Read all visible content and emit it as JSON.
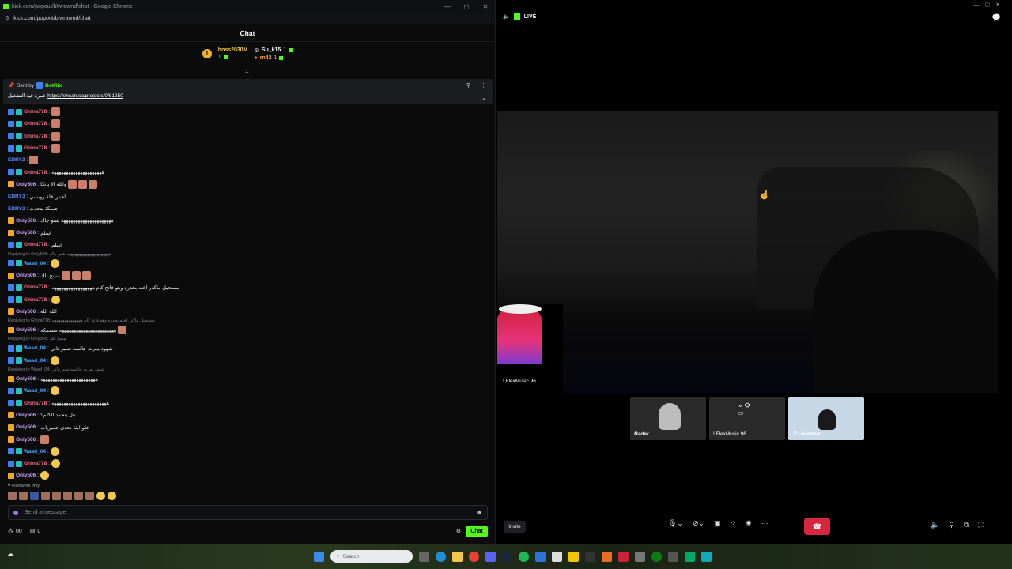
{
  "window": {
    "title": "kick.com/popout/blwrawnd/chat - Google Chrome",
    "url": "kick.com/popout/blwrawnd/chat"
  },
  "chat": {
    "header": "Chat",
    "gifters": [
      {
        "rank": "1",
        "name": "boss2030M",
        "count": "1"
      },
      {
        "name": "Su_k15",
        "count": "1"
      },
      {
        "name": "rn42",
        "count": "1"
      }
    ],
    "pinned": {
      "sent_by_label": "Sent by",
      "sender": "BotRix",
      "text": "عمرة قيد التشغيل",
      "link": "https://ehsan.sa/projects/0/81250"
    },
    "messages": [
      {
        "type": "msg",
        "user": "Ghina778",
        "color": "ghina",
        "badges": [
          "blue",
          "teal"
        ],
        "text": "",
        "emotes": 1
      },
      {
        "type": "msg",
        "user": "Ghina778",
        "color": "ghina",
        "badges": [
          "blue",
          "teal"
        ],
        "text": "",
        "emotes": 1
      },
      {
        "type": "msg",
        "user": "Ghina778",
        "color": "ghina",
        "badges": [
          "blue",
          "teal"
        ],
        "text": "",
        "emotes": 1
      },
      {
        "type": "msg",
        "user": "Ghina778",
        "color": "ghina",
        "badges": [
          "blue",
          "teal"
        ],
        "text": "",
        "emotes": 1
      },
      {
        "type": "msg",
        "user": "EDRY3",
        "color": "edry",
        "badges": [],
        "text": "",
        "emotes": 1
      },
      {
        "type": "msg",
        "user": "Ghina778",
        "color": "ghina",
        "badges": [
          "blue",
          "teal"
        ],
        "text": "هههههههههههههههههههههه",
        "emotes": 0
      },
      {
        "type": "msg",
        "user": "Only506",
        "color": "only",
        "badges": [
          "gold"
        ],
        "text": "والله الا يانكا",
        "emotes": 3
      },
      {
        "type": "msg",
        "user": "EDRY3",
        "color": "edry",
        "badges": [],
        "text": "احس فلة روبسي",
        "emotes": 0
      },
      {
        "type": "msg",
        "user": "EDRY3",
        "color": "edry",
        "badges": [],
        "text": "جملكة يتحدث",
        "emotes": 0
      },
      {
        "type": "msg",
        "user": "Only506",
        "color": "only",
        "badges": [
          "gold"
        ],
        "text": "هههههههههههههههههههههه شنو جاك",
        "emotes": 0
      },
      {
        "type": "msg",
        "user": "Only506",
        "color": "only",
        "badges": [
          "gold"
        ],
        "text": "اسلم",
        "emotes": 0
      },
      {
        "type": "msg",
        "user": "Ghina778",
        "color": "ghina",
        "badges": [
          "blue",
          "teal"
        ],
        "text": "اسلم",
        "emotes": 0
      },
      {
        "type": "reply",
        "text": "Replying to Only506: هههههههههههههههههههههه شنو جاك"
      },
      {
        "type": "msg",
        "user": "Waad_04",
        "color": "waad",
        "badges": [
          "blue",
          "teal"
        ],
        "text": "",
        "emotes": 1,
        "yellow": true
      },
      {
        "type": "msg",
        "user": "Only506",
        "color": "only",
        "badges": [
          "gold"
        ],
        "text": "مسح تلك",
        "emotes": 3
      },
      {
        "type": "msg",
        "user": "Ghina778",
        "color": "ghina",
        "badges": [
          "blue",
          "teal"
        ],
        "text": "مستحيل ماكدر اخله بحدره وهو فاتح كام هههههههههههههههههه",
        "emotes": 0
      },
      {
        "type": "msg",
        "user": "Ghina778",
        "color": "ghina",
        "badges": [
          "blue",
          "teal"
        ],
        "text": "",
        "emotes": 1,
        "yellow": true
      },
      {
        "type": "msg",
        "user": "Only506",
        "color": "only",
        "badges": [
          "gold"
        ],
        "text": "الله الله",
        "emotes": 0
      },
      {
        "type": "reply",
        "text": "Replying to Ghina778: مستحيل ماكدر اخله بحدره وهو فاتح كام ههههههههههههههه"
      },
      {
        "type": "msg",
        "user": "Only506",
        "color": "only",
        "badges": [
          "gold"
        ],
        "text": "هههههههههههههههههههههههه تقسمكه",
        "emotes": 1
      },
      {
        "type": "reply",
        "text": "Replying to Only506: مسح تلك"
      },
      {
        "type": "msg",
        "user": "Waad_04",
        "color": "waad",
        "badges": [
          "blue",
          "teal"
        ],
        "text": "شهود بمرت جالسه تسبرعاني",
        "emotes": 0
      },
      {
        "type": "msg",
        "user": "Waad_04",
        "color": "waad",
        "badges": [
          "blue",
          "teal"
        ],
        "text": "",
        "emotes": 1,
        "yellow": true
      },
      {
        "type": "reply",
        "text": "Replying to Waad_04: شهود بمرت جالسه تسبرعاني"
      },
      {
        "type": "msg",
        "user": "Only506",
        "color": "only",
        "badges": [
          "gold"
        ],
        "text": "هههههههههههههههههههههههه",
        "emotes": 0
      },
      {
        "type": "msg",
        "user": "Waad_04",
        "color": "waad",
        "badges": [
          "blue",
          "teal"
        ],
        "text": "",
        "emotes": 1,
        "yellow": true
      },
      {
        "type": "msg",
        "user": "Ghina778",
        "color": "ghina",
        "badges": [
          "blue",
          "teal"
        ],
        "text": "هههههههههههههههههههههههه",
        "emotes": 0
      },
      {
        "type": "msg",
        "user": "Only506",
        "color": "only",
        "badges": [
          "gold"
        ],
        "text": "هل يتحمد الكلم؟",
        "emotes": 0
      },
      {
        "type": "msg",
        "user": "Only506",
        "color": "only",
        "badges": [
          "gold"
        ],
        "text": "خلو ابلة نحدي جمبريات",
        "emotes": 0
      },
      {
        "type": "msg",
        "user": "Only506",
        "color": "only",
        "badges": [
          "gold"
        ],
        "text": "",
        "emotes": 1
      },
      {
        "type": "msg",
        "user": "Waad_04",
        "color": "waad",
        "badges": [
          "blue",
          "teal"
        ],
        "text": "",
        "emotes": 1,
        "yellow": true
      },
      {
        "type": "msg",
        "user": "Ghina778",
        "color": "ghina",
        "badges": [
          "blue",
          "teal"
        ],
        "text": "",
        "emotes": 1,
        "yellow": true
      },
      {
        "type": "msg",
        "user": "Only506",
        "color": "only",
        "badges": [
          "gold"
        ],
        "text": "",
        "emotes": 1,
        "yellow": true
      }
    ],
    "followers_only": "Followers only",
    "input_placeholder": "Send a message",
    "stat_1": "00",
    "stat_2": "0",
    "send_label": "Chat"
  },
  "stream": {
    "live_label": "LIVE",
    "speaker_name": "! FlexMusic 96",
    "participants": [
      {
        "name": "Bader"
      },
      {
        "name": "! FlexMusic 96"
      },
      {
        "name": "ℛ | Hamtaro"
      }
    ],
    "invite_label": "Invite"
  },
  "taskbar": {
    "search_placeholder": "Search"
  }
}
